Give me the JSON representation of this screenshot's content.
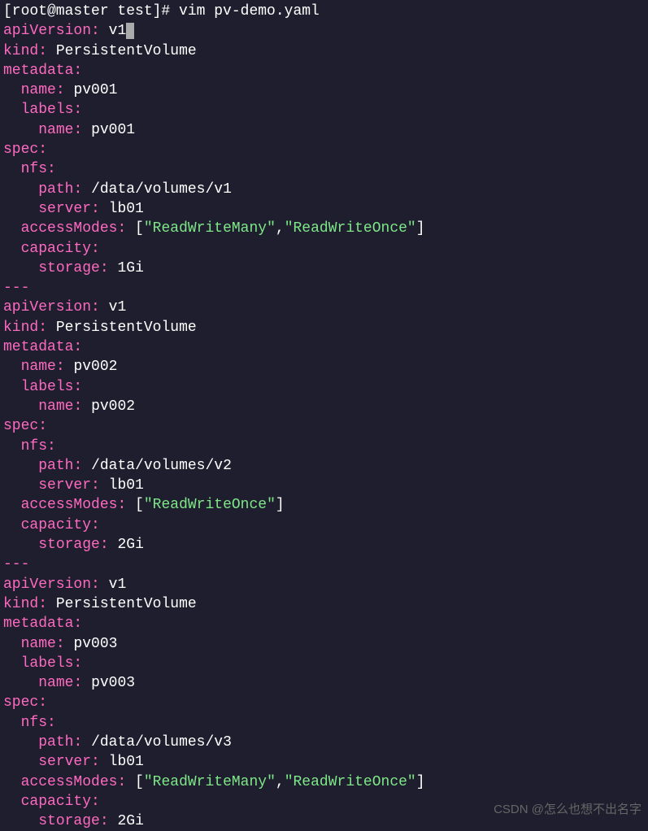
{
  "prompt": {
    "full": "[root@master test]# vim pv-demo.yaml"
  },
  "watermark": "CSDN @怎么也想不出名字",
  "docs": [
    {
      "apiVersion": "v1",
      "kind": "PersistentVolume",
      "name": "pv001",
      "labelName": "pv001",
      "path": "/data/volumes/v1",
      "server": "lb01",
      "accessModes": [
        "ReadWriteMany",
        "ReadWriteOnce"
      ],
      "storage": "1Gi",
      "hasCursor": true
    },
    {
      "apiVersion": "v1",
      "kind": "PersistentVolume",
      "name": "pv002",
      "labelName": "pv002",
      "path": "/data/volumes/v2",
      "server": "lb01",
      "accessModes": [
        "ReadWriteOnce"
      ],
      "storage": "2Gi",
      "hasCursor": false
    },
    {
      "apiVersion": "v1",
      "kind": "PersistentVolume",
      "name": "pv003",
      "labelName": "pv003",
      "path": "/data/volumes/v3",
      "server": "lb01",
      "accessModes": [
        "ReadWriteMany",
        "ReadWriteOnce"
      ],
      "storage": "2Gi",
      "hasCursor": false
    }
  ],
  "keys": {
    "apiVersion": "apiVersion",
    "kind": "kind",
    "metadata": "metadata",
    "name": "name",
    "labels": "labels",
    "spec": "spec",
    "nfs": "nfs",
    "path": "path",
    "server": "server",
    "accessModes": "accessModes",
    "capacity": "capacity",
    "storage": "storage"
  },
  "separator": "---"
}
